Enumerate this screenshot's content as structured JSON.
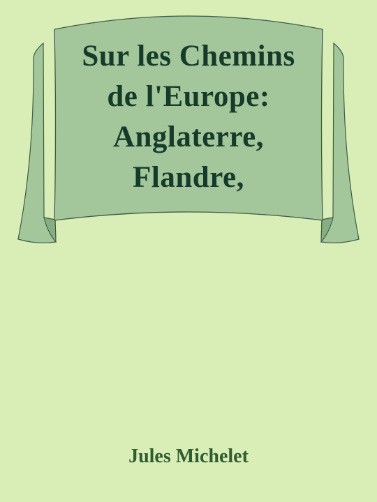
{
  "cover": {
    "title_lines": [
      "Sur les Chemins",
      "de l'Europe:",
      "Anglaterre,",
      "Flandre,"
    ],
    "author": "Jules Michelet"
  },
  "colors": {
    "background": "#d9edb6",
    "banner_fill": "#a3c79b",
    "banner_shadow": "#86ad83",
    "banner_outline": "#3d5c46",
    "title_text": "#173b2a",
    "author_text": "#2f5d31"
  },
  "icons": {
    "banner": "ribbon-banner-icon"
  }
}
